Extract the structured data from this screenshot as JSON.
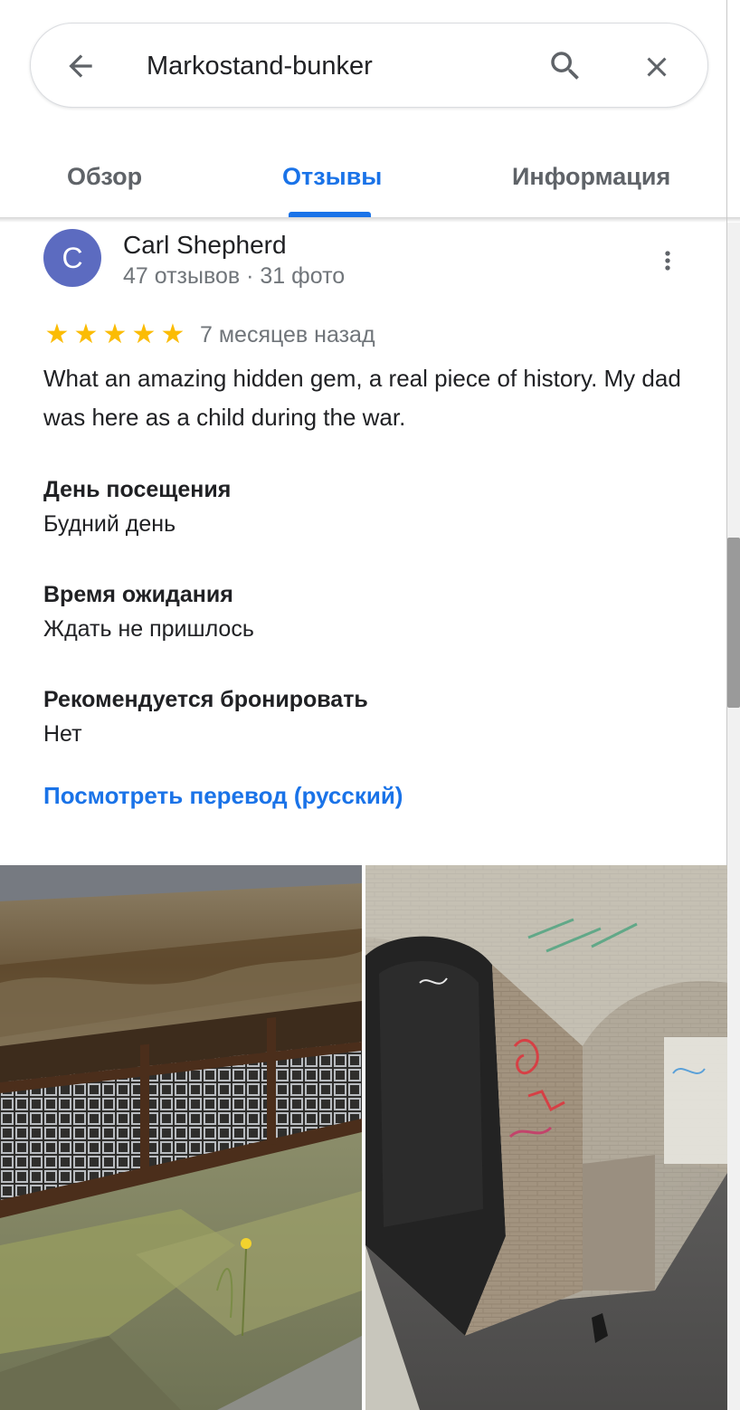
{
  "search": {
    "query": "Markostand-bunker",
    "back_icon": "arrow-left-icon",
    "search_icon": "search-icon",
    "close_icon": "close-icon"
  },
  "tabs": [
    {
      "label": "Обзор",
      "active": false
    },
    {
      "label": "Отзывы",
      "active": true
    },
    {
      "label": "Информация",
      "active": false
    }
  ],
  "review": {
    "avatar_letter": "C",
    "avatar_color": "#5c6bc0",
    "name": "Carl Shepherd",
    "meta": "47 отзывов · 31 фото",
    "rating": 5,
    "star_glyph": "★",
    "date": "7 месяцев назад",
    "text": "What an amazing hidden gem, a real piece of history. My dad was here as a child during the war.",
    "fields": [
      {
        "label": "День посещения",
        "value": "Будний день"
      },
      {
        "label": "Время ожидания",
        "value": "Ждать не пришлось"
      },
      {
        "label": "Рекомендуется бронировать",
        "value": "Нет"
      }
    ],
    "translate_link": "Посмотреть перевод (русский)",
    "photos": [
      {
        "description_icon": "photo-grate-icon"
      },
      {
        "description_icon": "photo-tunnel-icon"
      }
    ]
  },
  "colors": {
    "accent": "#1a73e8",
    "star": "#fbbc04",
    "secondary_text": "#70757a"
  }
}
